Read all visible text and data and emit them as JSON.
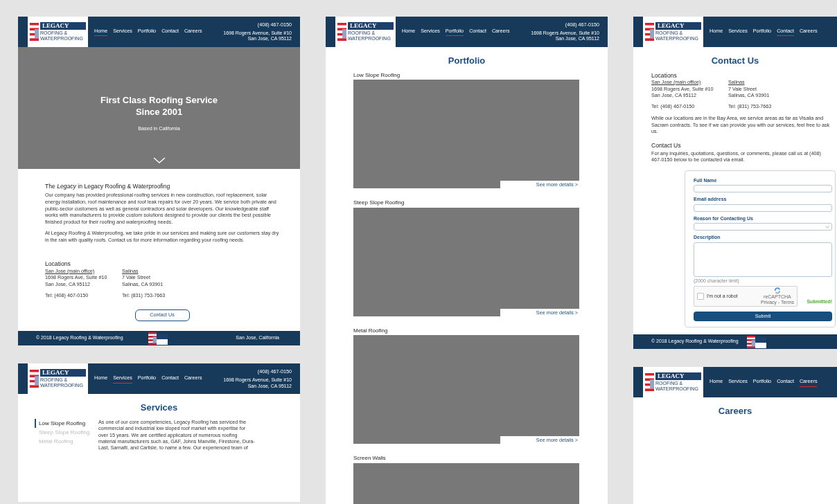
{
  "home": {
    "header": {
      "logo": {
        "name": "LEGACY",
        "tagline": "ROOFING & WATERPROOFING"
      },
      "nav": [
        {
          "label": "Home",
          "selected": true
        },
        {
          "label": "Services",
          "selected": false
        },
        {
          "label": "Portfolio",
          "selected": false
        },
        {
          "label": "Contact",
          "selected": false
        },
        {
          "label": "Careers",
          "selected": false
        }
      ],
      "phone": "(408) 467-0150",
      "address": [
        "1698 Rogers Avenue, Suite #10",
        "San Jose, CA 95112"
      ]
    },
    "hero": {
      "title_lines": [
        "First Class Roofing Service",
        "Since 2001"
      ],
      "subtitle": "Based in California"
    },
    "about": {
      "heading": "The *Legacy* in Legacy Roofing & Waterproofing",
      "paragraphs": [
        "Our company has provided professional roofing services in new construction, roof replacement, solar energy installation, roof maintenance and roof leak repairs for over 20 years. We service both private and public-sector customers as well as general contractors and solar developers. Our knowledgeable staff works with manufacturers to provide custom solutions designed to provide our clients the best possible finished product for their roofing and waterproofing needs.",
        "At Legacy Roofing & Waterproofing, we take pride in our services and making sure our customers stay dry in the rain with quality roofs. Contact us for more information regarding your roofing needs."
      ]
    },
    "locations": {
      "heading": "Locations",
      "offices": [
        {
          "name": "San Jose (main office)",
          "lines": [
            "1698 Rogers Ave, Suite #10",
            "San Jose, CA 95112"
          ],
          "tel": "Tel: (408) 467-0150"
        },
        {
          "name": "Salinas",
          "lines": [
            "7 Vale Street",
            "Salinas, CA 93901"
          ],
          "tel": "Tel: (831) 753-7663"
        }
      ]
    },
    "contact_button": "Contact Us",
    "footer": {
      "copyright": "© 2018 Legacy Roofing & Waterproofing",
      "location": "San Jose, California"
    }
  },
  "services": {
    "header": {
      "logo": {
        "name": "LEGACY",
        "tagline": "ROOFING & WATERPROOFING"
      },
      "nav": [
        {
          "label": "Home",
          "selected": false
        },
        {
          "label": "Services",
          "selected": true
        },
        {
          "label": "Portfolio",
          "selected": false
        },
        {
          "label": "Contact",
          "selected": false
        },
        {
          "label": "Careers",
          "selected": false
        }
      ],
      "phone": "(408) 467-0150",
      "address": [
        "1698 Rogers Avenue, Suite #10",
        "San Jose, CA 95112"
      ]
    },
    "title": "Services",
    "menu": [
      {
        "label": "Low Slope Roofing",
        "selected": true
      },
      {
        "label": "Steep Slope Roofing",
        "selected": false
      },
      {
        "label": "Metal Roofing",
        "selected": false
      }
    ],
    "text_lines": [
      "As one of our core competencies, Legacy Roofing has serviced the",
      "commercial and industrial low sloped roof market with expertise for",
      "over 15 years. We are certified applicators of numerous roofing",
      "material manufacturers such as, GAF, Johns Manville, Firestone, Dura-",
      "Last, Sarnafil, and Carlisle, to name a few. Our experienced team of"
    ]
  },
  "portfolio": {
    "header": {
      "logo": {
        "name": "LEGACY",
        "tagline": "ROOFING & WATERPROOFING"
      },
      "nav": [
        {
          "label": "Home",
          "selected": false
        },
        {
          "label": "Services",
          "selected": false
        },
        {
          "label": "Portfolio",
          "selected": true
        },
        {
          "label": "Contact",
          "selected": false
        },
        {
          "label": "Careers",
          "selected": false
        }
      ],
      "phone": "(408) 467-0150",
      "address": [
        "1698 Rogers Avenue, Suite #10",
        "San Jose, CA 95112"
      ]
    },
    "title": "Portfolio",
    "sections": [
      {
        "heading": "Low Slope Roofing",
        "link": "See more details >"
      },
      {
        "heading": "Steep Slope Roofing",
        "link": "See more details >"
      },
      {
        "heading": "Metal Roofing",
        "link": "See more details >"
      },
      {
        "heading": "Screen Walls"
      }
    ]
  },
  "contact": {
    "header": {
      "logo": {
        "name": "LEGACY",
        "tagline": "ROOFING & WATERPROOFING"
      },
      "nav": [
        {
          "label": "Home",
          "selected": false
        },
        {
          "label": "Services",
          "selected": false
        },
        {
          "label": "Portfolio",
          "selected": false
        },
        {
          "label": "Contact",
          "selected": true
        },
        {
          "label": "Careers",
          "selected": false
        }
      ]
    },
    "title": "Contact Us",
    "locations": {
      "heading": "Locations",
      "offices": [
        {
          "name": "San Jose (main office)",
          "lines": [
            "1698 Rogers Ave, Suite #10",
            "San Jose, CA 95112"
          ],
          "tel": "Tel: (408) 467-0150"
        },
        {
          "name": "Salinas",
          "lines": [
            "7 Vale Street",
            "Salinas, CA 93901"
          ],
          "tel": "Tel: (831) 753-7663"
        }
      ]
    },
    "note_lines": [
      "While our locations are in the Bay Area, we service areas as far as Visalia and Sacram",
      "contracts. To see if we can provide you with our services, feel free to ask us."
    ],
    "contact_heading": "Contact Us",
    "contact_lines": [
      "For any inquiries, quotations, questions, or comments, please call us at (408) 467-0150",
      "below to be contacted via email."
    ],
    "form": {
      "fields": [
        {
          "kind": "text",
          "label": "Full Name"
        },
        {
          "kind": "text",
          "label": "Email address"
        },
        {
          "kind": "select",
          "label": "Reason for Contacting Us"
        },
        {
          "kind": "textarea",
          "label": "Description",
          "hint": "(2000 character limit)"
        }
      ],
      "captcha": {
        "label": "I'm not a robot",
        "checked": false,
        "brand": "reCAPTCHA",
        "links": "Privacy - Terms"
      },
      "status": "Submitted!",
      "submit": "Submit"
    },
    "footer": {
      "copyright": "© 2018 Legacy Roofing & Waterproofing"
    }
  },
  "careers": {
    "header": {
      "logo": {
        "name": "LEGACY",
        "tagline": "ROOFING & WATERPROOFING"
      },
      "nav": [
        {
          "label": "Home",
          "selected": false
        },
        {
          "label": "Services",
          "selected": false
        },
        {
          "label": "Portfolio",
          "selected": false
        },
        {
          "label": "Contact",
          "selected": false
        },
        {
          "label": "Careers",
          "selected": true
        }
      ]
    },
    "title": "Careers"
  }
}
